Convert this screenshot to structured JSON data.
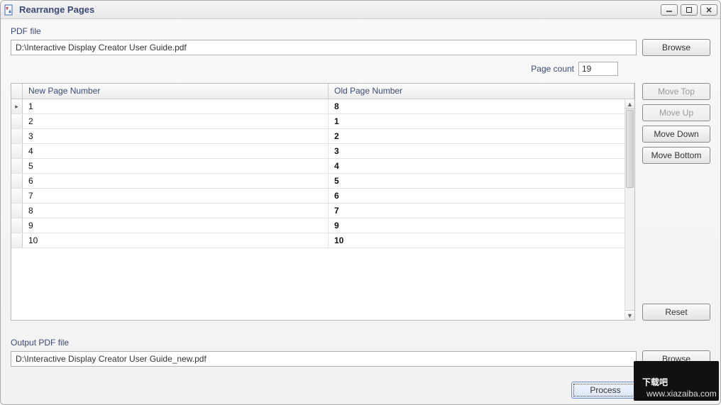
{
  "window": {
    "title": "Rearrange Pages"
  },
  "pdf_file": {
    "label": "PDF file",
    "value": "D:\\Interactive Display Creator User Guide.pdf",
    "browse_label": "Browse"
  },
  "page_count": {
    "label": "Page count",
    "value": "19"
  },
  "grid": {
    "col_new": "New Page Number",
    "col_old": "Old Page Number",
    "rows": [
      {
        "new": "1",
        "old": "8",
        "marker": "▸"
      },
      {
        "new": "2",
        "old": "1",
        "marker": ""
      },
      {
        "new": "3",
        "old": "2",
        "marker": ""
      },
      {
        "new": "4",
        "old": "3",
        "marker": ""
      },
      {
        "new": "5",
        "old": "4",
        "marker": ""
      },
      {
        "new": "6",
        "old": "5",
        "marker": ""
      },
      {
        "new": "7",
        "old": "6",
        "marker": ""
      },
      {
        "new": "8",
        "old": "7",
        "marker": ""
      },
      {
        "new": "9",
        "old": "9",
        "marker": ""
      },
      {
        "new": "10",
        "old": "10",
        "marker": ""
      }
    ]
  },
  "buttons": {
    "move_top": "Move Top",
    "move_up": "Move Up",
    "move_down": "Move Down",
    "move_bottom": "Move Bottom",
    "reset": "Reset",
    "process": "Process"
  },
  "button_states": {
    "move_top_disabled": true,
    "move_up_disabled": true,
    "move_down_disabled": false,
    "move_bottom_disabled": false
  },
  "output_pdf": {
    "label": "Output PDF file",
    "value": "D:\\Interactive Display Creator User Guide_new.pdf",
    "browse_label": "Browse"
  },
  "watermark": {
    "text_cn": "下载吧",
    "text_url": "www.xiazaiba.com"
  }
}
